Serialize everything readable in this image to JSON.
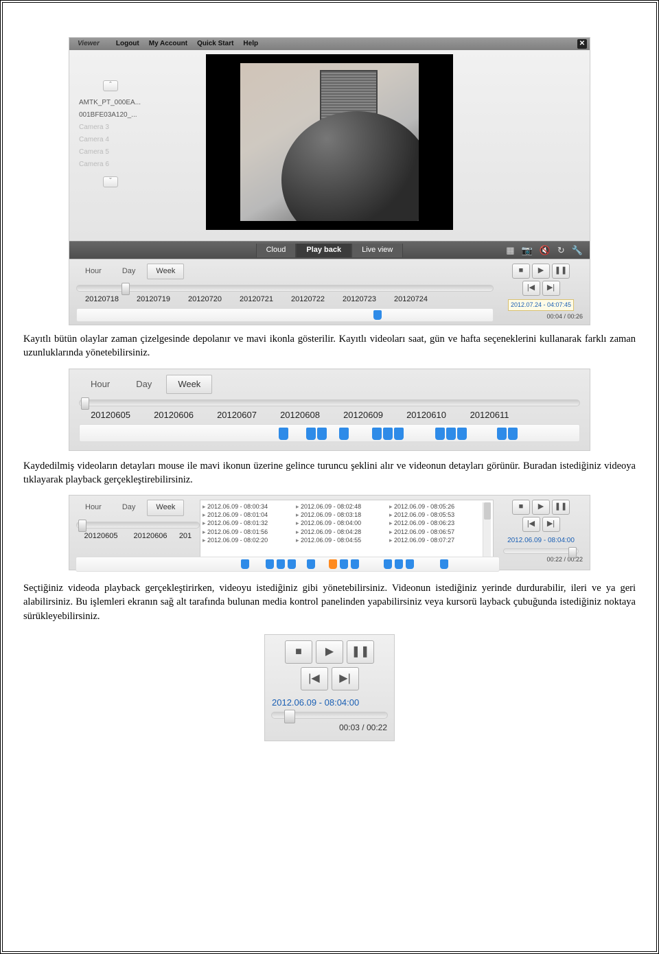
{
  "shot1": {
    "topbar": {
      "brand": "Viewer",
      "links": [
        "Logout",
        "My Account",
        "Quick Start",
        "Help"
      ]
    },
    "sidebar": {
      "items": [
        "AMTK_PT_000EA...",
        "001BFE03A120_..."
      ],
      "dim_items": [
        "Camera 3",
        "Camera 4",
        "Camera 5",
        "Camera 6"
      ]
    },
    "modes": {
      "cloud": "Cloud",
      "playback": "Play back",
      "liveview": "Live view"
    },
    "tabs": {
      "hour": "Hour",
      "day": "Day",
      "week": "Week"
    },
    "dates": [
      "20120718",
      "20120719",
      "20120720",
      "20120721",
      "20120722",
      "20120723",
      "20120724"
    ],
    "clip_time": "2012.07.24 - 04:07:45",
    "elapsed": "00:04 / 00:26"
  },
  "para1": "Kayıtlı bütün olaylar zaman çizelgesinde depolanır ve mavi ikonla gösterilir. Kayıtlı videoları saat, gün ve hafta seçeneklerini kullanarak farklı zaman uzunluklarında yönetebilirsiniz.",
  "shot2": {
    "tabs": {
      "hour": "Hour",
      "day": "Day",
      "week": "Week"
    },
    "dates": [
      "20120605",
      "20120606",
      "20120607",
      "20120608",
      "20120609",
      "20120610",
      "20120611"
    ]
  },
  "para2": "Kaydedilmiş videoların detayları mouse ile mavi ikonun üzerine gelince turuncu şeklini alır ve videonun detayları görünür. Buradan istediğiniz videoya tıklayarak playback gerçekleştirebilirsiniz.",
  "shot3": {
    "tabs": {
      "hour": "Hour",
      "day": "Day",
      "week": "Week"
    },
    "dates_left": [
      "20120605",
      "20120606",
      "201"
    ],
    "popup": {
      "col1": [
        "2012.06.09 - 08:00:34",
        "2012.06.09 - 08:01:04",
        "2012.06.09 - 08:01:32",
        "2012.06.09 - 08:01:56",
        "2012.06.09 - 08:02:20"
      ],
      "col2": [
        "2012.06.09 - 08:02:48",
        "2012.06.09 - 08:03:18",
        "2012.06.09 - 08:04:00",
        "2012.06.09 - 08:04:28",
        "2012.06.09 - 08:04:55"
      ],
      "col3": [
        "2012.06.09 - 08:05:26",
        "2012.06.09 - 08:05:53",
        "2012.06.09 - 08:06:23",
        "2012.06.09 - 08:06:57",
        "2012.06.09 - 08:07:27"
      ]
    },
    "clip_time": "2012.06.09 - 08:04:00",
    "elapsed": "00:22 / 00:22"
  },
  "para3": "Seçtiğiniz videoda playback gerçekleştirirken, videoyu istediğiniz gibi yönetebilirsiniz. Videonun istediğiniz yerinde durdurabilir, ileri ve ya geri alabilirsiniz. Bu işlemleri ekranın sağ alt tarafında bulunan media kontrol panelinden yapabilirsiniz veya kursorü layback çubuğunda istediğiniz noktaya sürükleyebilirsiniz.",
  "shot4": {
    "clip_time": "2012.06.09 - 08:04:00",
    "elapsed": "00:03 / 00:22"
  }
}
